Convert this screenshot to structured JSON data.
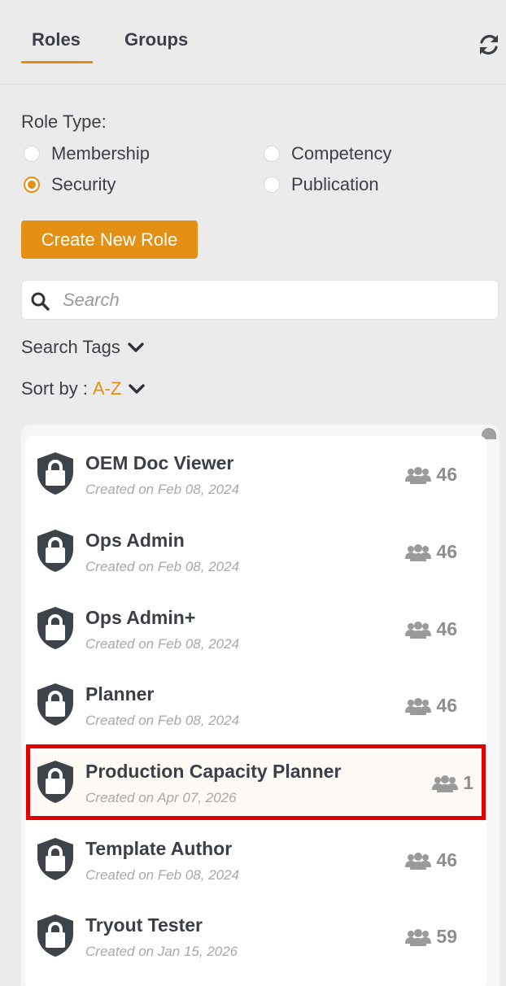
{
  "tabs": [
    {
      "label": "Roles"
    },
    {
      "label": "Groups"
    }
  ],
  "role_type": {
    "label": "Role Type:",
    "options": [
      {
        "label": "Membership",
        "checked": false
      },
      {
        "label": "Competency",
        "checked": false
      },
      {
        "label": "Security",
        "checked": true
      },
      {
        "label": "Publication",
        "checked": false
      }
    ]
  },
  "create_button": "Create New Role",
  "search": {
    "placeholder": "Search"
  },
  "search_tags": "Search Tags",
  "sort": {
    "label": "Sort by :",
    "value": "A-Z"
  },
  "colors": {
    "accent": "#e39014",
    "highlight": "#e10000"
  },
  "roles": [
    {
      "name": "OEM Doc Viewer",
      "created": "Created on Feb 08, 2024",
      "members": "46",
      "icon": "shield-lock-icon"
    },
    {
      "name": "Ops Admin",
      "created": "Created on Feb 08, 2024",
      "members": "46",
      "icon": "shield-lock-icon"
    },
    {
      "name": "Ops Admin+",
      "created": "Created on Feb 08, 2024",
      "members": "46",
      "icon": "shield-lock-icon"
    },
    {
      "name": "Planner",
      "created": "Created on Feb 08, 2024",
      "members": "46",
      "icon": "shield-lock-icon"
    },
    {
      "name": "Production Capacity Planner",
      "created": "Created on Apr 07, 2026",
      "members": "1",
      "icon": "shield-lock-icon",
      "highlighted": true
    },
    {
      "name": "Template Author",
      "created": "Created on Feb 08, 2024",
      "members": "46",
      "icon": "shield-lock-icon"
    },
    {
      "name": "Tryout Tester",
      "created": "Created on Jan 15, 2026",
      "members": "59",
      "icon": "shield-lock-icon"
    }
  ]
}
